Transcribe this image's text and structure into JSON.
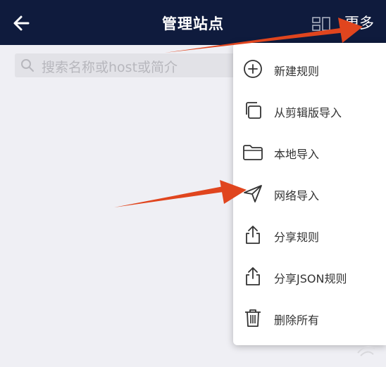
{
  "header": {
    "title": "管理站点",
    "more_label": "更多"
  },
  "search": {
    "placeholder": "搜索名称或host或简介"
  },
  "menu": {
    "items": [
      {
        "label": "新建规则",
        "icon": "plus-circle-icon"
      },
      {
        "label": "从剪辑版导入",
        "icon": "copy-icon"
      },
      {
        "label": "本地导入",
        "icon": "folder-icon"
      },
      {
        "label": "网络导入",
        "icon": "send-icon"
      },
      {
        "label": "分享规则",
        "icon": "share-icon"
      },
      {
        "label": "分享JSON规则",
        "icon": "share-icon"
      },
      {
        "label": "删除所有",
        "icon": "trash-icon"
      }
    ]
  },
  "colors": {
    "appbar": "#0f1b3d",
    "background": "#efeff4",
    "annotation_arrow": "#e0451e"
  }
}
